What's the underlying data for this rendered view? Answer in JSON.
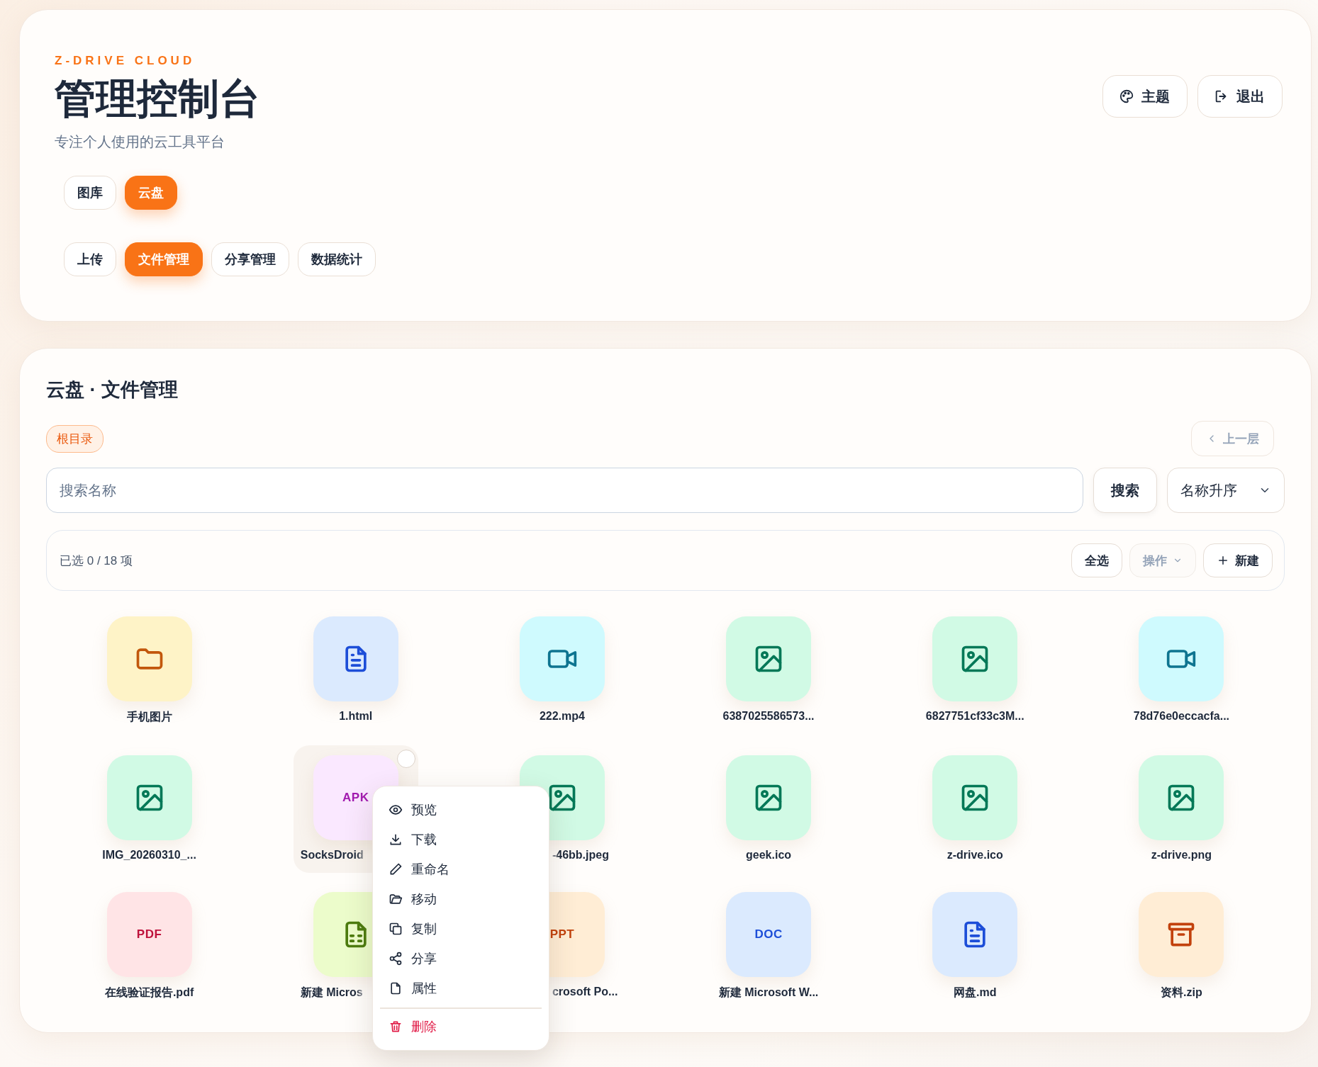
{
  "header": {
    "brand": "Z-DRIVE CLOUD",
    "title": "管理控制台",
    "subtitle": "专注个人使用的云工具平台",
    "actions": [
      {
        "label": "主题"
      },
      {
        "label": "退出"
      }
    ],
    "app_tabs": [
      {
        "label": "图库",
        "selected": false
      },
      {
        "label": "云盘",
        "selected": true
      }
    ],
    "section_tabs": [
      {
        "label": "上传",
        "selected": false
      },
      {
        "label": "文件管理",
        "selected": true
      },
      {
        "label": "分享管理",
        "selected": false
      },
      {
        "label": "数据统计",
        "selected": false
      }
    ]
  },
  "panel": {
    "title": "云盘 · 文件管理",
    "breadcrumb": "根目录",
    "up_button": {
      "label": "上一层",
      "disabled": true
    },
    "search": {
      "placeholder": "搜索名称",
      "button": "搜索"
    },
    "sort": {
      "value": "名称升序"
    },
    "toolbar": {
      "selection": "已选 0 / 18 项",
      "select_all": "全选",
      "actions": {
        "label": "操作",
        "disabled": true
      },
      "new": "新建"
    },
    "files": [
      {
        "kind": "folder",
        "label": "手机图片",
        "selected": false,
        "hovered": false,
        "cut_end": false,
        "cut_start": false
      },
      {
        "kind": "text",
        "label": "1.html",
        "selected": false,
        "hovered": false,
        "cut_end": false,
        "cut_start": false
      },
      {
        "kind": "video",
        "label": "222.mp4",
        "selected": false,
        "hovered": false,
        "cut_end": false,
        "cut_start": false
      },
      {
        "kind": "image",
        "label": "6387025586573...",
        "selected": false,
        "hovered": false,
        "cut_end": false,
        "cut_start": false
      },
      {
        "kind": "image",
        "label": "6827751cf33c3M...",
        "selected": false,
        "hovered": false,
        "cut_end": false,
        "cut_start": false
      },
      {
        "kind": "video",
        "label": "78d76e0eccacfa...",
        "selected": false,
        "hovered": false,
        "cut_end": false,
        "cut_start": false
      },
      {
        "kind": "image",
        "label": "IMG_20260310_...",
        "selected": false,
        "hovered": false,
        "cut_end": false,
        "cut_start": false
      },
      {
        "kind": "apk",
        "badge": "APK",
        "label": "SocksDroid",
        "selected": false,
        "hovered": true,
        "cut_end": true,
        "cut_start": false
      },
      {
        "kind": "image",
        "label": "-46bb.jpeg",
        "selected": false,
        "hovered": false,
        "cut_end": false,
        "cut_start": true
      },
      {
        "kind": "image",
        "label": "geek.ico",
        "selected": false,
        "hovered": false,
        "cut_end": false,
        "cut_start": false
      },
      {
        "kind": "image",
        "label": "z-drive.ico",
        "selected": false,
        "hovered": false,
        "cut_end": false,
        "cut_start": false
      },
      {
        "kind": "image",
        "label": "z-drive.png",
        "selected": false,
        "hovered": false,
        "cut_end": false,
        "cut_start": false
      },
      {
        "kind": "pdf",
        "badge": "PDF",
        "label": "在线验证报告.pdf",
        "selected": false,
        "hovered": false,
        "cut_end": false,
        "cut_start": false
      },
      {
        "kind": "sheet",
        "label": "新建 Micros",
        "selected": false,
        "hovered": false,
        "cut_end": true,
        "cut_start": false
      },
      {
        "kind": "ppt",
        "badge": "PPT",
        "label": "crosoft Po...",
        "selected": false,
        "hovered": false,
        "cut_end": false,
        "cut_start": true
      },
      {
        "kind": "doc",
        "badge": "DOC",
        "label": "新建 Microsoft W...",
        "selected": false,
        "hovered": false,
        "cut_end": false,
        "cut_start": false
      },
      {
        "kind": "text",
        "label": "网盘.md",
        "selected": false,
        "hovered": false,
        "cut_end": false,
        "cut_start": false
      },
      {
        "kind": "archive",
        "label": "资料.zip",
        "selected": false,
        "hovered": false,
        "cut_end": false,
        "cut_start": false
      }
    ],
    "context_menu": [
      {
        "label": "预览",
        "danger": false
      },
      {
        "label": "下载",
        "danger": false
      },
      {
        "label": "重命名",
        "danger": false
      },
      {
        "label": "移动",
        "danger": false
      },
      {
        "label": "复制",
        "danger": false
      },
      {
        "label": "分享",
        "danger": false
      },
      {
        "label": "属性",
        "danger": false
      },
      {
        "label": "删除",
        "danger": true
      }
    ]
  }
}
